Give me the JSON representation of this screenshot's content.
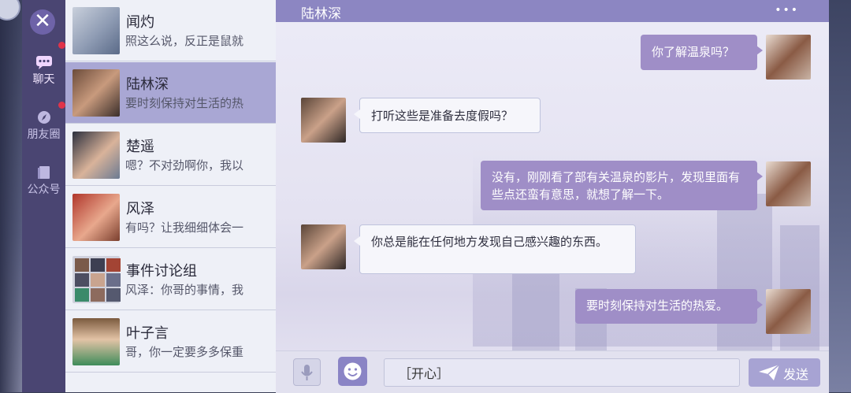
{
  "rail": {
    "items": [
      {
        "label": "聊天",
        "icon": "chat-icon"
      },
      {
        "label": "朋友圈",
        "icon": "compass-icon"
      },
      {
        "label": "公众号",
        "icon": "book-icon"
      }
    ]
  },
  "contacts": [
    {
      "name": "闻灼",
      "preview": "照这么说，反正是鼠就"
    },
    {
      "name": "陆林深",
      "preview": "要时刻保持对生活的热"
    },
    {
      "name": "楚遥",
      "preview": "嗯？不对劲啊你，我以"
    },
    {
      "name": "风泽",
      "preview": "有吗？让我细细体会一"
    },
    {
      "name": "事件讨论组",
      "preview": "风泽：你哥的事情，我"
    },
    {
      "name": "叶子言",
      "preview": "哥，你一定要多多保重"
    }
  ],
  "chat": {
    "title": "陆林深",
    "more": "•••",
    "messages": [
      {
        "from": "me",
        "text": "你了解温泉吗？"
      },
      {
        "from": "them",
        "text": "打听这些是准备去度假吗？"
      },
      {
        "from": "me",
        "text": "没有，刚刚看了部有关温泉的影片，发现里面有些点还蛮有意思，就想了解一下。"
      },
      {
        "from": "them",
        "text": "你总是能在任何地方发现自己感兴趣的东西。"
      },
      {
        "from": "me",
        "text": "要时刻保持对生活的热爱。"
      }
    ]
  },
  "input": {
    "value": "［开心］",
    "send_label": "发送"
  },
  "colors": {
    "accent": "#8c86c2",
    "bubble_me": "#9f8ec7",
    "rail": "#4a4572",
    "unread": "#e0334a"
  }
}
